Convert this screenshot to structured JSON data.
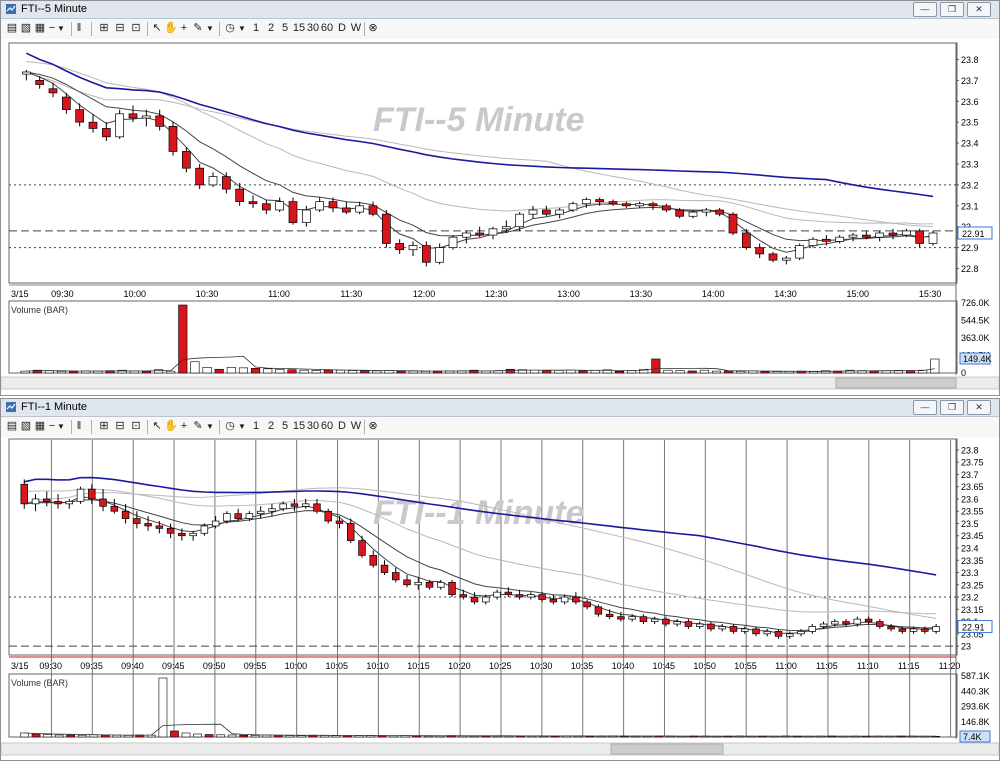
{
  "colors": {
    "up": "#ffffff",
    "down": "#d8141c",
    "ma_blue": "#1a1aa0",
    "ma_dark": "#444444",
    "ma_light": "#b8b8b8",
    "grid": "#555555",
    "current_tag": "#3a7ad0"
  },
  "toolbar": {
    "timeframes": [
      "1",
      "2",
      "5",
      "15",
      "30",
      "60",
      "D",
      "W"
    ],
    "icons": [
      "dropdown-icon",
      "pause-icon",
      "pointer-icon",
      "hand-icon",
      "crosshair-icon",
      "pencil-icon",
      "clock-icon",
      "close-circle-icon"
    ]
  },
  "window_buttons": [
    "minimize-icon",
    "restore-icon",
    "close-icon"
  ],
  "top": {
    "title": "FTI--5 Minute",
    "watermark": "FTI--5 Minute",
    "price_axis": [
      "23.8",
      "23.7",
      "23.6",
      "23.5",
      "23.4",
      "23.3",
      "23.2",
      "23.1",
      "23",
      "22.9",
      "22.8"
    ],
    "current_price": "22.91",
    "date_label": "3/15",
    "time_labels": [
      "09:30",
      "10:00",
      "10:30",
      "11:00",
      "11:30",
      "12:00",
      "12:30",
      "13:00",
      "13:30",
      "14:00",
      "14:30",
      "15:00",
      "15:30"
    ],
    "volume_title": "Volume (BAR)",
    "volume_axis": [
      "726.0K",
      "544.5K",
      "363.0K",
      "181.5K",
      "0"
    ],
    "current_volume": "149.4K"
  },
  "bottom": {
    "title": "FTI--1 Minute",
    "watermark": "FTI--1 Minute",
    "price_axis": [
      "23.8",
      "23.75",
      "23.7",
      "23.65",
      "23.6",
      "23.55",
      "23.5",
      "23.45",
      "23.4",
      "23.35",
      "23.3",
      "23.25",
      "23.2",
      "23.15",
      "23.1",
      "23.05",
      "23"
    ],
    "current_price": "22.91",
    "date_label": "3/15",
    "time_labels": [
      "09:30",
      "09:35",
      "09:40",
      "09:45",
      "09:50",
      "09:55",
      "10:00",
      "10:05",
      "10:10",
      "10:15",
      "10:20",
      "10:25",
      "10:30",
      "10:35",
      "10:40",
      "10:45",
      "10:50",
      "10:55",
      "11:00",
      "11:05",
      "11:10",
      "11:15",
      "11:20"
    ],
    "volume_title": "Volume (BAR)",
    "volume_axis": [
      "587.1K",
      "440.3K",
      "293.6K",
      "146.8K",
      "0"
    ],
    "current_volume": "7.4K"
  },
  "chart_data": [
    {
      "type": "candlestick",
      "title": "FTI--5 Minute",
      "x_start": "09:25",
      "interval_minutes": 5,
      "ylim": [
        22.75,
        23.85
      ],
      "grid_levels": [
        23.2,
        22.98,
        22.9
      ],
      "ohlc": [
        [
          23.73,
          23.75,
          23.7,
          23.74
        ],
        [
          23.7,
          23.72,
          23.66,
          23.68
        ],
        [
          23.66,
          23.69,
          23.62,
          23.64
        ],
        [
          23.62,
          23.64,
          23.54,
          23.56
        ],
        [
          23.56,
          23.59,
          23.48,
          23.5
        ],
        [
          23.5,
          23.54,
          23.45,
          23.47
        ],
        [
          23.47,
          23.5,
          23.41,
          23.43
        ],
        [
          23.43,
          23.56,
          23.42,
          23.54
        ],
        [
          23.54,
          23.58,
          23.5,
          23.52
        ],
        [
          23.52,
          23.56,
          23.48,
          23.53
        ],
        [
          23.53,
          23.56,
          23.46,
          23.48
        ],
        [
          23.48,
          23.5,
          23.34,
          23.36
        ],
        [
          23.36,
          23.38,
          23.26,
          23.28
        ],
        [
          23.28,
          23.3,
          23.18,
          23.2
        ],
        [
          23.2,
          23.26,
          23.19,
          23.24
        ],
        [
          23.24,
          23.26,
          23.16,
          23.18
        ],
        [
          23.18,
          23.21,
          23.1,
          23.12
        ],
        [
          23.12,
          23.15,
          23.09,
          23.11
        ],
        [
          23.11,
          23.13,
          23.06,
          23.08
        ],
        [
          23.08,
          23.14,
          23.07,
          23.12
        ],
        [
          23.12,
          23.14,
          23.01,
          23.02
        ],
        [
          23.02,
          23.1,
          23.0,
          23.08
        ],
        [
          23.08,
          23.14,
          23.07,
          23.12
        ],
        [
          23.12,
          23.14,
          23.07,
          23.09
        ],
        [
          23.09,
          23.12,
          23.06,
          23.07
        ],
        [
          23.07,
          23.12,
          23.06,
          23.1
        ],
        [
          23.1,
          23.12,
          23.05,
          23.06
        ],
        [
          23.06,
          23.08,
          22.9,
          22.92
        ],
        [
          22.92,
          22.94,
          22.87,
          22.89
        ],
        [
          22.89,
          22.93,
          22.86,
          22.91
        ],
        [
          22.91,
          22.93,
          22.81,
          22.83
        ],
        [
          22.83,
          22.92,
          22.82,
          22.9
        ],
        [
          22.9,
          22.96,
          22.89,
          22.95
        ],
        [
          22.95,
          22.98,
          22.92,
          22.97
        ],
        [
          22.97,
          23.0,
          22.95,
          22.96
        ],
        [
          22.96,
          23.0,
          22.94,
          22.99
        ],
        [
          22.99,
          23.03,
          22.97,
          23.0
        ],
        [
          23.0,
          23.07,
          22.98,
          23.06
        ],
        [
          23.06,
          23.1,
          23.04,
          23.08
        ],
        [
          23.08,
          23.1,
          23.05,
          23.06
        ],
        [
          23.06,
          23.09,
          23.04,
          23.08
        ],
        [
          23.08,
          23.12,
          23.07,
          23.11
        ],
        [
          23.11,
          23.14,
          23.09,
          23.13
        ],
        [
          23.13,
          23.14,
          23.1,
          23.12
        ],
        [
          23.12,
          23.13,
          23.1,
          23.11
        ],
        [
          23.11,
          23.12,
          23.09,
          23.1
        ],
        [
          23.1,
          23.12,
          23.09,
          23.11
        ],
        [
          23.11,
          23.12,
          23.08,
          23.1
        ],
        [
          23.1,
          23.11,
          23.07,
          23.08
        ],
        [
          23.08,
          23.09,
          23.04,
          23.05
        ],
        [
          23.05,
          23.08,
          23.04,
          23.07
        ],
        [
          23.07,
          23.09,
          23.05,
          23.08
        ],
        [
          23.08,
          23.09,
          23.05,
          23.06
        ],
        [
          23.06,
          23.07,
          22.96,
          22.97
        ],
        [
          22.97,
          22.99,
          22.89,
          22.9
        ],
        [
          22.9,
          22.92,
          22.85,
          22.87
        ],
        [
          22.87,
          22.88,
          22.83,
          22.84
        ],
        [
          22.84,
          22.86,
          22.82,
          22.85
        ],
        [
          22.85,
          22.92,
          22.84,
          22.91
        ],
        [
          22.91,
          22.95,
          22.9,
          22.94
        ],
        [
          22.94,
          22.96,
          22.91,
          22.93
        ],
        [
          22.93,
          22.96,
          22.92,
          22.95
        ],
        [
          22.95,
          22.97,
          22.93,
          22.96
        ],
        [
          22.96,
          22.98,
          22.94,
          22.95
        ],
        [
          22.95,
          22.98,
          22.93,
          22.97
        ],
        [
          22.97,
          22.99,
          22.94,
          22.96
        ],
        [
          22.96,
          22.99,
          22.95,
          22.98
        ],
        [
          22.98,
          22.99,
          22.9,
          22.92
        ],
        [
          22.92,
          22.98,
          22.91,
          22.97
        ]
      ],
      "volume": [
        20,
        30,
        25,
        18,
        15,
        22,
        20,
        25,
        30,
        22,
        18,
        35,
        20,
        726,
        120,
        60,
        40,
        60,
        55,
        50,
        45,
        40,
        35,
        30,
        28,
        32,
        30,
        26,
        24,
        22,
        25,
        20,
        22,
        18,
        20,
        22,
        24,
        30,
        22,
        26,
        40,
        35,
        30,
        28,
        28,
        30,
        22,
        30,
        34,
        18,
        24,
        40,
        150,
        30,
        26,
        22,
        30,
        20,
        22,
        18,
        24,
        14,
        16,
        18,
        20,
        16,
        24,
        20,
        30,
        26,
        22,
        24,
        28,
        26,
        30,
        149.4
      ],
      "volume_ylim": [
        0,
        726
      ],
      "volume_unit": "K"
    },
    {
      "type": "candlestick",
      "title": "FTI--1 Minute",
      "x_start": "09:26",
      "interval_minutes": 1,
      "ylim": [
        22.98,
        23.82
      ],
      "grid_levels": [
        23.2,
        23.0
      ],
      "ohlc": [
        [
          23.66,
          23.68,
          23.56,
          23.58
        ],
        [
          23.58,
          23.62,
          23.55,
          23.6
        ],
        [
          23.6,
          23.63,
          23.57,
          23.59
        ],
        [
          23.59,
          23.62,
          23.56,
          23.58
        ],
        [
          23.58,
          23.6,
          23.56,
          23.59
        ],
        [
          23.59,
          23.65,
          23.58,
          23.64
        ],
        [
          23.64,
          23.66,
          23.58,
          23.6
        ],
        [
          23.6,
          23.64,
          23.55,
          23.57
        ],
        [
          23.57,
          23.6,
          23.54,
          23.55
        ],
        [
          23.55,
          23.58,
          23.5,
          23.52
        ],
        [
          23.52,
          23.55,
          23.48,
          23.5
        ],
        [
          23.5,
          23.53,
          23.47,
          23.49
        ],
        [
          23.49,
          23.51,
          23.46,
          23.48
        ],
        [
          23.48,
          23.5,
          23.44,
          23.46
        ],
        [
          23.46,
          23.48,
          23.43,
          23.45
        ],
        [
          23.45,
          23.47,
          23.43,
          23.46
        ],
        [
          23.46,
          23.5,
          23.45,
          23.49
        ],
        [
          23.49,
          23.53,
          23.48,
          23.51
        ],
        [
          23.51,
          23.55,
          23.5,
          23.54
        ],
        [
          23.54,
          23.56,
          23.51,
          23.52
        ],
        [
          23.52,
          23.55,
          23.51,
          23.54
        ],
        [
          23.54,
          23.57,
          23.52,
          23.55
        ],
        [
          23.55,
          23.58,
          23.53,
          23.56
        ],
        [
          23.56,
          23.59,
          23.55,
          23.58
        ],
        [
          23.58,
          23.6,
          23.55,
          23.57
        ],
        [
          23.57,
          23.6,
          23.56,
          23.58
        ],
        [
          23.58,
          23.6,
          23.54,
          23.55
        ],
        [
          23.55,
          23.56,
          23.5,
          23.51
        ],
        [
          23.51,
          23.53,
          23.48,
          23.5
        ],
        [
          23.5,
          23.52,
          23.42,
          23.43
        ],
        [
          23.43,
          23.45,
          23.36,
          23.37
        ],
        [
          23.37,
          23.39,
          23.32,
          23.33
        ],
        [
          23.33,
          23.35,
          23.29,
          23.3
        ],
        [
          23.3,
          23.32,
          23.26,
          23.27
        ],
        [
          23.27,
          23.29,
          23.24,
          23.25
        ],
        [
          23.25,
          23.28,
          23.23,
          23.26
        ],
        [
          23.26,
          23.27,
          23.23,
          23.24
        ],
        [
          23.24,
          23.27,
          23.23,
          23.26
        ],
        [
          23.26,
          23.27,
          23.2,
          23.21
        ],
        [
          23.21,
          23.23,
          23.19,
          23.2
        ],
        [
          23.2,
          23.22,
          23.17,
          23.18
        ],
        [
          23.18,
          23.21,
          23.17,
          23.2
        ],
        [
          23.2,
          23.23,
          23.19,
          23.22
        ],
        [
          23.22,
          23.24,
          23.2,
          23.21
        ],
        [
          23.21,
          23.23,
          23.19,
          23.2
        ],
        [
          23.2,
          23.22,
          23.19,
          23.21
        ],
        [
          23.21,
          23.22,
          23.18,
          23.19
        ],
        [
          23.19,
          23.21,
          23.17,
          23.18
        ],
        [
          23.18,
          23.21,
          23.17,
          23.2
        ],
        [
          23.2,
          23.22,
          23.17,
          23.18
        ],
        [
          23.18,
          23.19,
          23.15,
          23.16
        ],
        [
          23.16,
          23.17,
          23.12,
          23.13
        ],
        [
          23.13,
          23.15,
          23.11,
          23.12
        ],
        [
          23.12,
          23.14,
          23.1,
          23.11
        ],
        [
          23.11,
          23.13,
          23.1,
          23.12
        ],
        [
          23.12,
          23.13,
          23.09,
          23.1
        ],
        [
          23.1,
          23.12,
          23.09,
          23.11
        ],
        [
          23.11,
          23.12,
          23.08,
          23.09
        ],
        [
          23.09,
          23.11,
          23.08,
          23.1
        ],
        [
          23.1,
          23.11,
          23.07,
          23.08
        ],
        [
          23.08,
          23.1,
          23.07,
          23.09
        ],
        [
          23.09,
          23.1,
          23.06,
          23.07
        ],
        [
          23.07,
          23.09,
          23.06,
          23.08
        ],
        [
          23.08,
          23.09,
          23.05,
          23.06
        ],
        [
          23.06,
          23.08,
          23.05,
          23.07
        ],
        [
          23.07,
          23.08,
          23.04,
          23.05
        ],
        [
          23.05,
          23.07,
          23.04,
          23.06
        ],
        [
          23.06,
          23.07,
          23.03,
          23.04
        ],
        [
          23.04,
          23.06,
          23.03,
          23.05
        ],
        [
          23.05,
          23.07,
          23.04,
          23.06
        ],
        [
          23.06,
          23.09,
          23.05,
          23.08
        ],
        [
          23.08,
          23.1,
          23.07,
          23.09
        ],
        [
          23.09,
          23.11,
          23.08,
          23.1
        ],
        [
          23.1,
          23.11,
          23.08,
          23.09
        ],
        [
          23.09,
          23.12,
          23.08,
          23.11
        ],
        [
          23.11,
          23.12,
          23.09,
          23.1
        ],
        [
          23.1,
          23.11,
          23.07,
          23.08
        ],
        [
          23.08,
          23.09,
          23.06,
          23.07
        ],
        [
          23.07,
          23.08,
          23.05,
          23.06
        ],
        [
          23.06,
          23.08,
          23.05,
          23.07
        ],
        [
          23.07,
          23.08,
          23.05,
          23.06
        ],
        [
          23.06,
          23.09,
          23.05,
          23.08
        ]
      ],
      "volume": [
        40,
        30,
        25,
        20,
        20,
        18,
        22,
        20,
        18,
        16,
        20,
        18,
        587,
        60,
        40,
        30,
        25,
        22,
        20,
        18,
        16,
        20,
        18,
        15,
        14,
        18,
        16,
        14,
        12,
        14,
        16,
        14,
        12,
        14,
        12,
        10,
        12,
        14,
        12,
        10,
        12,
        10,
        11,
        12,
        10,
        9,
        10,
        12,
        10,
        9,
        10,
        11,
        10,
        9,
        8,
        10,
        9,
        8,
        10,
        9,
        8,
        9,
        10,
        8,
        9,
        8,
        10,
        9,
        8,
        9,
        10,
        8,
        9,
        8,
        9,
        8,
        10,
        9,
        8,
        7.4
      ],
      "volume_ylim": [
        0,
        587.1
      ],
      "volume_unit": "K"
    }
  ]
}
